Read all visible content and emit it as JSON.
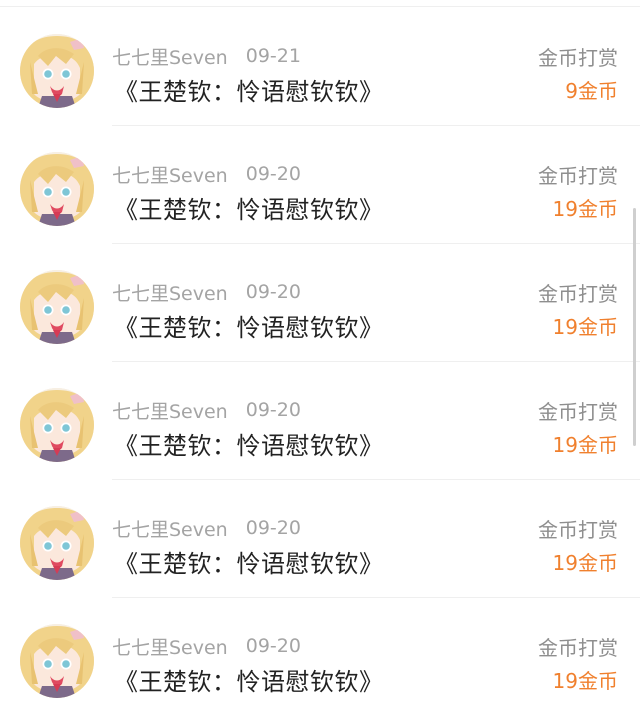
{
  "list": {
    "items": [
      {
        "username": "七七里Seven",
        "date": "09-21",
        "title": "《王楚钦：怜语慰钦钦》",
        "reward_type": "金币打赏",
        "reward_amount": "9金币",
        "avatar_icon": "anime-girl-avatar"
      },
      {
        "username": "七七里Seven",
        "date": "09-20",
        "title": "《王楚钦：怜语慰钦钦》",
        "reward_type": "金币打赏",
        "reward_amount": "19金币",
        "avatar_icon": "anime-girl-avatar"
      },
      {
        "username": "七七里Seven",
        "date": "09-20",
        "title": "《王楚钦：怜语慰钦钦》",
        "reward_type": "金币打赏",
        "reward_amount": "19金币",
        "avatar_icon": "anime-girl-avatar"
      },
      {
        "username": "七七里Seven",
        "date": "09-20",
        "title": "《王楚钦：怜语慰钦钦》",
        "reward_type": "金币打赏",
        "reward_amount": "19金币",
        "avatar_icon": "anime-girl-avatar"
      },
      {
        "username": "七七里Seven",
        "date": "09-20",
        "title": "《王楚钦：怜语慰钦钦》",
        "reward_type": "金币打赏",
        "reward_amount": "19金币",
        "avatar_icon": "anime-girl-avatar"
      },
      {
        "username": "七七里Seven",
        "date": "09-20",
        "title": "《王楚钦：怜语慰钦钦》",
        "reward_type": "金币打赏",
        "reward_amount": "19金币",
        "avatar_icon": "anime-girl-avatar"
      }
    ]
  },
  "colors": {
    "accent_orange": "#f0802e",
    "secondary_text": "#a4a4a4",
    "primary_text": "#222222",
    "divider": "#efefef"
  }
}
